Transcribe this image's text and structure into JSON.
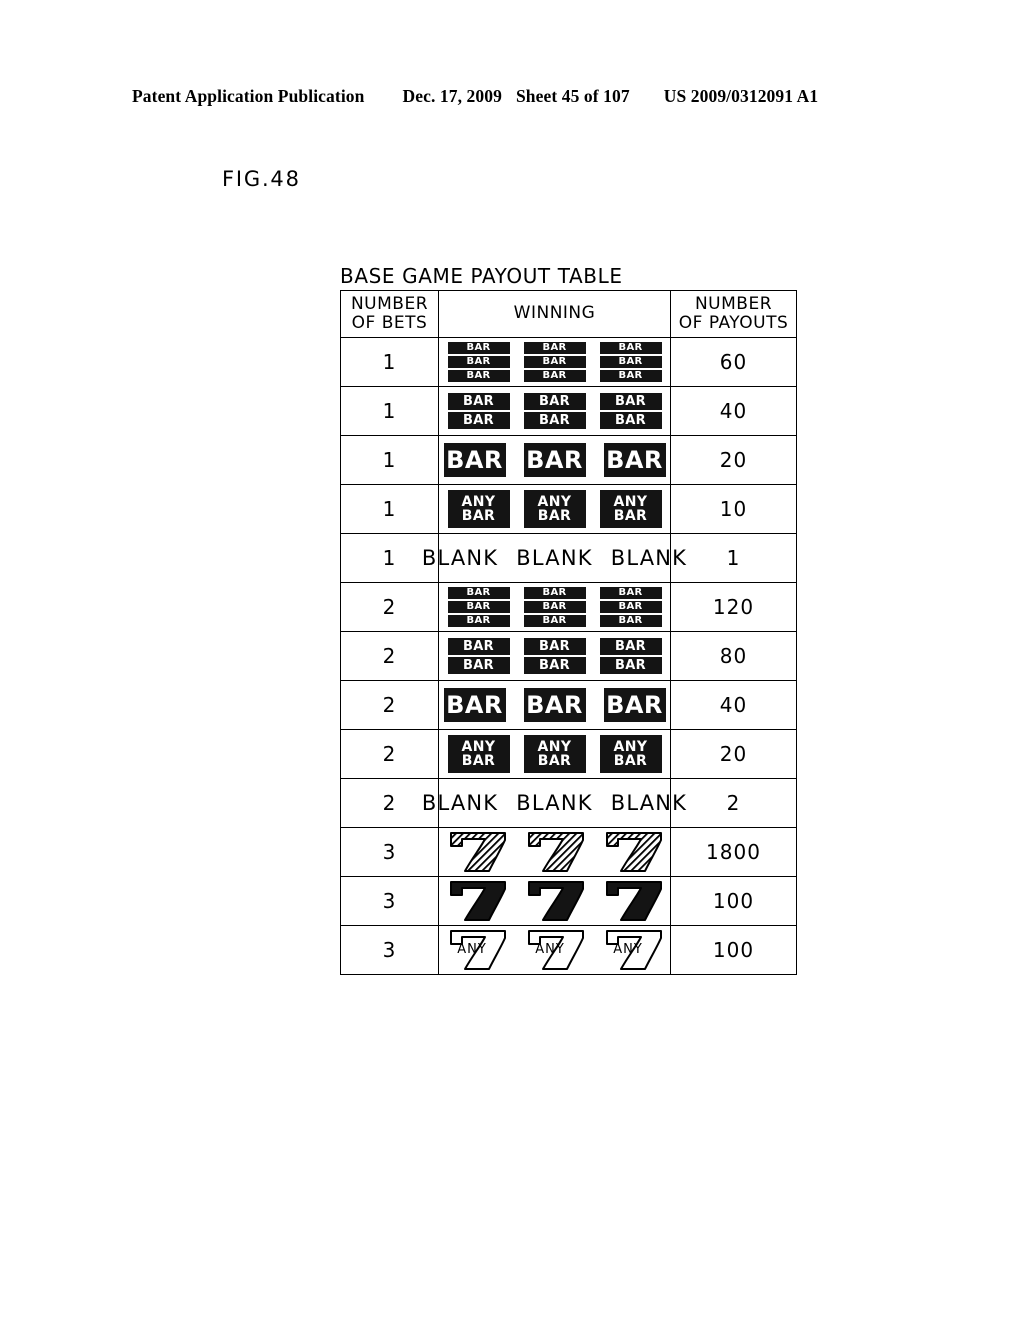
{
  "header": {
    "publication": "Patent Application Publication",
    "date": "Dec. 17, 2009",
    "sheet": "Sheet 45 of 107",
    "patent_number": "US 2009/0312091 A1"
  },
  "figure": {
    "label": "FIG.48"
  },
  "table": {
    "title": "BASE GAME PAYOUT TABLE",
    "columns": {
      "bets_line1": "NUMBER",
      "bets_line2": "OF BETS",
      "winning": "WINNING",
      "payouts_line1": "NUMBER",
      "payouts_line2": "OF PAYOUTS"
    },
    "symbol_labels": {
      "bar": "BAR",
      "any_line1": "ANY",
      "any_line2": "BAR",
      "blank": "BLANK",
      "any_seven": "ANY"
    },
    "rows": [
      {
        "bets": "1",
        "symbol_type": "triple-bar",
        "payout": "60"
      },
      {
        "bets": "1",
        "symbol_type": "double-bar",
        "payout": "40"
      },
      {
        "bets": "1",
        "symbol_type": "single-bar",
        "payout": "20"
      },
      {
        "bets": "1",
        "symbol_type": "any-bar",
        "payout": "10"
      },
      {
        "bets": "1",
        "symbol_type": "blank",
        "payout": "1"
      },
      {
        "bets": "2",
        "symbol_type": "triple-bar",
        "payout": "120"
      },
      {
        "bets": "2",
        "symbol_type": "double-bar",
        "payout": "80"
      },
      {
        "bets": "2",
        "symbol_type": "single-bar",
        "payout": "40"
      },
      {
        "bets": "2",
        "symbol_type": "any-bar",
        "payout": "20"
      },
      {
        "bets": "2",
        "symbol_type": "blank",
        "payout": "2"
      },
      {
        "bets": "3",
        "symbol_type": "hatched-seven",
        "payout": "1800"
      },
      {
        "bets": "3",
        "symbol_type": "solid-seven",
        "payout": "100"
      },
      {
        "bets": "3",
        "symbol_type": "any-seven",
        "payout": "100"
      }
    ]
  },
  "colors": {
    "ink": "#000000",
    "paper": "#ffffff",
    "symbol_fill": "#141414"
  }
}
